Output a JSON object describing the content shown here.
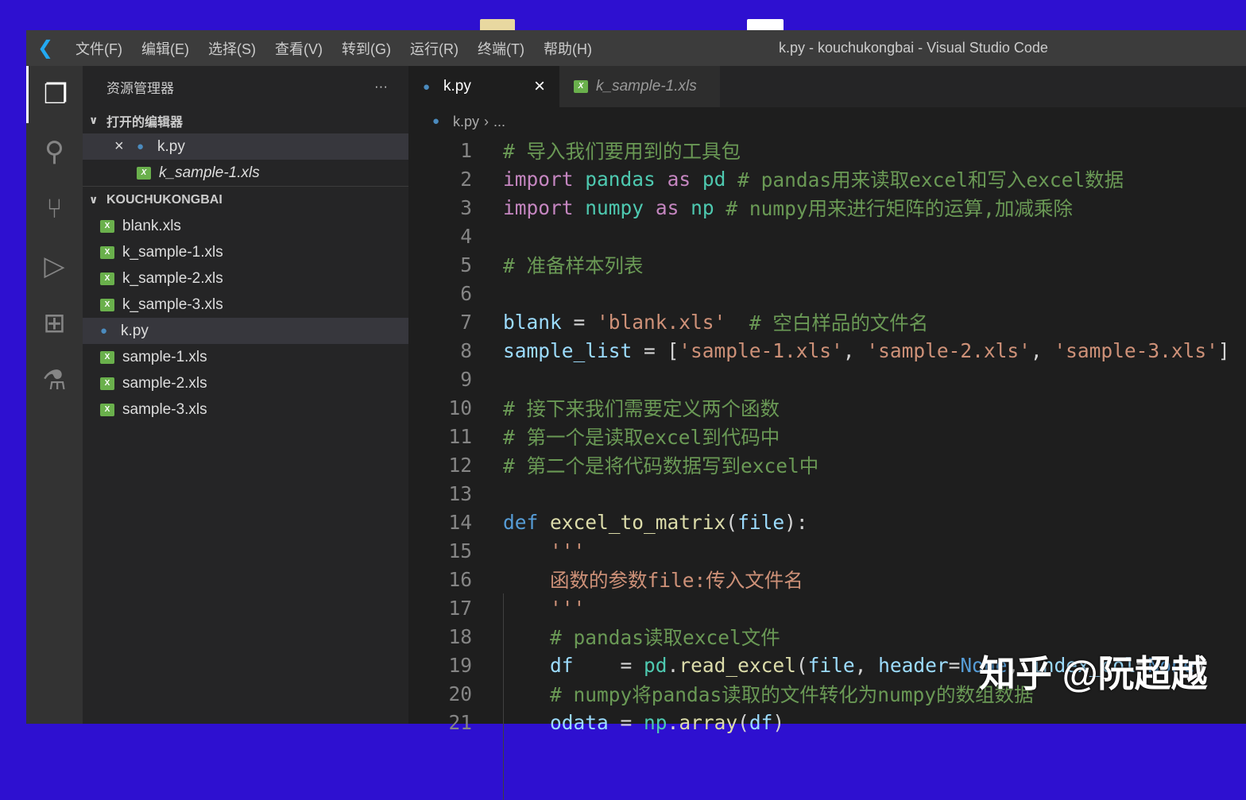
{
  "window": {
    "title": "k.py - kouchukongbai - Visual Studio Code"
  },
  "menu": [
    "文件(F)",
    "编辑(E)",
    "选择(S)",
    "查看(V)",
    "转到(G)",
    "运行(R)",
    "终端(T)",
    "帮助(H)"
  ],
  "sidebar": {
    "title": "资源管理器",
    "more": "···",
    "open_editors": {
      "label": "打开的编辑器",
      "items": [
        "k.py",
        "k_sample-1.xls"
      ]
    },
    "folder": {
      "label": "KOUCHUKONGBAI",
      "items": [
        {
          "name": "blank.xls",
          "type": "xls"
        },
        {
          "name": "k_sample-1.xls",
          "type": "xls"
        },
        {
          "name": "k_sample-2.xls",
          "type": "xls"
        },
        {
          "name": "k_sample-3.xls",
          "type": "xls"
        },
        {
          "name": "k.py",
          "type": "py",
          "selected": true
        },
        {
          "name": "sample-1.xls",
          "type": "xls"
        },
        {
          "name": "sample-2.xls",
          "type": "xls"
        },
        {
          "name": "sample-3.xls",
          "type": "xls"
        }
      ]
    }
  },
  "tabs": [
    {
      "label": "k.py",
      "close": "×"
    },
    {
      "label": "k_sample-1.xls"
    }
  ],
  "breadcrumb": {
    "file": "k.py",
    "rest": "..."
  },
  "code": [
    [
      [
        "# 导入我们要用到的工具包",
        "c"
      ]
    ],
    [
      [
        "import",
        "k"
      ],
      [
        " "
      ],
      [
        "pandas",
        "m"
      ],
      [
        " "
      ],
      [
        "as",
        "k"
      ],
      [
        " "
      ],
      [
        "pd",
        "m"
      ],
      [
        " "
      ],
      [
        "# pandas用来读取excel和写入excel数据",
        "c"
      ]
    ],
    [
      [
        "import",
        "k"
      ],
      [
        " "
      ],
      [
        "numpy",
        "m"
      ],
      [
        " "
      ],
      [
        "as",
        "k"
      ],
      [
        " "
      ],
      [
        "np",
        "m"
      ],
      [
        " "
      ],
      [
        "# numpy用来进行矩阵的运算,加减乘除",
        "c"
      ]
    ],
    [],
    [
      [
        "# 准备样本列表",
        "c"
      ]
    ],
    [],
    [
      [
        "blank",
        "v"
      ],
      [
        " = ",
        "p"
      ],
      [
        "'blank.xls'",
        "s"
      ],
      [
        "  "
      ],
      [
        "# 空白样品的文件名",
        "c"
      ]
    ],
    [
      [
        "sample_list",
        "v"
      ],
      [
        " = [",
        "p"
      ],
      [
        "'sample-1.xls'",
        "s"
      ],
      [
        ", ",
        "p"
      ],
      [
        "'sample-2.xls'",
        "s"
      ],
      [
        ", ",
        "p"
      ],
      [
        "'sample-3.xls'",
        "s"
      ],
      [
        "]",
        "p"
      ]
    ],
    [],
    [
      [
        "# 接下来我们需要定义两个函数",
        "c"
      ]
    ],
    [
      [
        "# 第一个是读取excel到代码中",
        "c"
      ]
    ],
    [
      [
        "# 第二个是将代码数据写到excel中",
        "c"
      ]
    ],
    [],
    [
      [
        "def",
        "b"
      ],
      [
        " "
      ],
      [
        "excel_to_matrix",
        "f"
      ],
      [
        "(",
        "p"
      ],
      [
        "file",
        "v"
      ],
      [
        "):",
        "p"
      ]
    ],
    [
      [
        "    "
      ],
      [
        "'''",
        "s"
      ]
    ],
    [
      [
        "    "
      ],
      [
        "函数的参数file:传入文件名",
        "s"
      ]
    ],
    [
      [
        "    "
      ],
      [
        "'''",
        "s"
      ]
    ],
    [
      [
        "    "
      ],
      [
        "# pandas读取excel文件",
        "c"
      ]
    ],
    [
      [
        "    "
      ],
      [
        "df",
        "v"
      ],
      [
        "    = ",
        "p"
      ],
      [
        "pd",
        "m"
      ],
      [
        ".",
        "p"
      ],
      [
        "read_excel",
        "f"
      ],
      [
        "(",
        "p"
      ],
      [
        "file",
        "v"
      ],
      [
        ", ",
        "p"
      ],
      [
        "header",
        "v"
      ],
      [
        "=",
        "p"
      ],
      [
        "None",
        "b"
      ],
      [
        ", ",
        "p"
      ],
      [
        "index_col",
        "v"
      ],
      [
        "=",
        "p"
      ],
      [
        "None",
        "b"
      ],
      [
        ")",
        "p"
      ]
    ],
    [
      [
        "    "
      ],
      [
        "# numpy将pandas读取的文件转化为numpy的数组数据",
        "c"
      ]
    ],
    [
      [
        "    "
      ],
      [
        "odata",
        "v"
      ],
      [
        " = ",
        "p"
      ],
      [
        "np",
        "m"
      ],
      [
        ".",
        "p"
      ],
      [
        "array",
        "f"
      ],
      [
        "(",
        "p"
      ],
      [
        "df",
        "v"
      ],
      [
        ")",
        "p"
      ]
    ]
  ],
  "watermark": "知乎 @阮超越"
}
